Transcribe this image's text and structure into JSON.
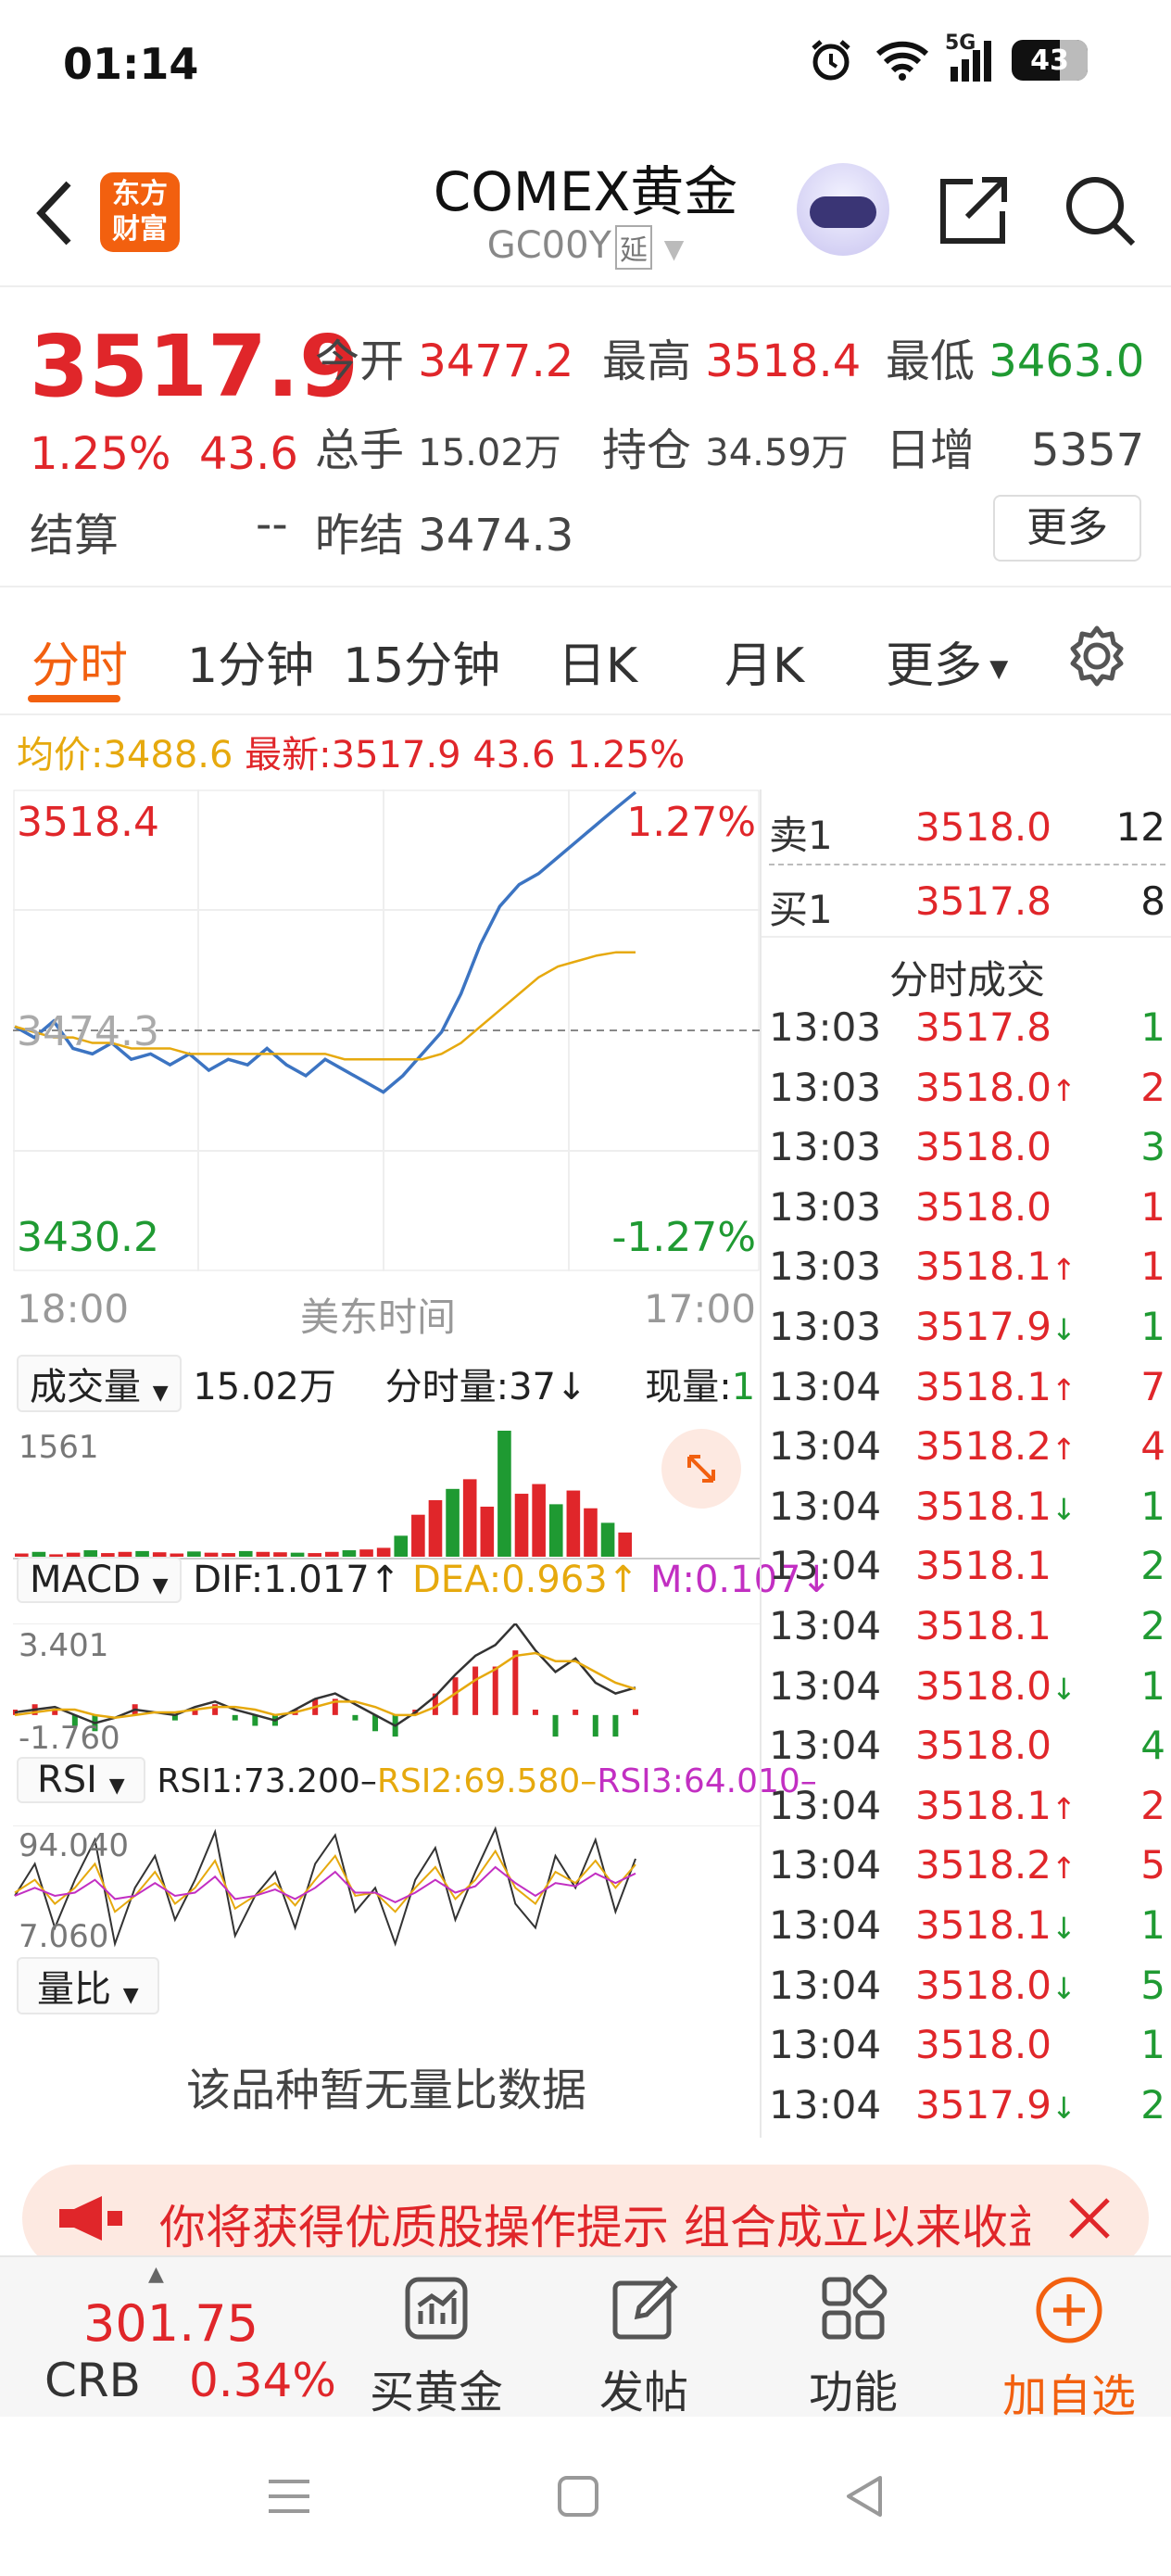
{
  "status_bar": {
    "time": "01:14",
    "network": "5G",
    "battery": "43"
  },
  "header": {
    "title": "COMEX黄金",
    "code": "GC00Y",
    "delay_tag": "延",
    "logo_text_1": "东方",
    "logo_text_2": "财富"
  },
  "quote": {
    "price": "3517.9",
    "change_pct": "1.25%",
    "change": "43.6",
    "open_label": "今开",
    "open": "3477.2",
    "high_label": "最高",
    "high": "3518.4",
    "low_label": "最低",
    "low": "3463.0",
    "volume_label": "总手",
    "volume": "15.02万",
    "oi_label": "持仓",
    "oi": "34.59万",
    "daily_inc_label": "日增",
    "daily_inc": "5357",
    "settle_label": "结算",
    "settle": "--",
    "prev_settle_label": "昨结",
    "prev_settle": "3474.3",
    "more_label": "更多"
  },
  "tabs": [
    {
      "label": "分时"
    },
    {
      "label": "1分钟"
    },
    {
      "label": "15分钟"
    },
    {
      "label": "日K"
    },
    {
      "label": "月K"
    },
    {
      "label": "更多"
    }
  ],
  "avg_line": {
    "avg_label": "均价:",
    "avg": "3488.6",
    "latest_label": "最新:",
    "latest": "3517.9",
    "chg": "43.6",
    "pct": "1.25%"
  },
  "chart_data": [
    {
      "type": "line",
      "x_start_label": "18:00",
      "x_end_label": "17:00",
      "x_center_label": "美东时间",
      "y_top": "3518.4",
      "y_bottom": "3430.2",
      "y_mid": "3474.3",
      "pct_top": "1.27%",
      "pct_bottom": "-1.27%",
      "ylim": [
        3430.2,
        3518.4
      ],
      "series": [
        {
          "values": [
            3475,
            3473,
            3476,
            3471,
            3470,
            3472,
            3469,
            3470,
            3468,
            3470,
            3467,
            3469,
            3468,
            3471,
            3468,
            3466,
            3469,
            3467,
            3465,
            3463,
            3466,
            3470,
            3474,
            3481,
            3490,
            3497,
            3501,
            3503,
            3506,
            3509,
            3512,
            3515,
            3517.9
          ]
        },
        {
          "values": [
            3475,
            3474,
            3473,
            3473,
            3472,
            3472,
            3471,
            3471,
            3471,
            3470,
            3470,
            3470,
            3470,
            3470,
            3470,
            3470,
            3470,
            3469,
            3469,
            3469,
            3469,
            3469,
            3470,
            3472,
            3475,
            3478,
            3481,
            3484,
            3486,
            3487,
            3488,
            3488.6,
            3488.6
          ]
        }
      ]
    },
    {
      "type": "bar",
      "ymax": "1561",
      "values": [
        40,
        60,
        30,
        50,
        80,
        45,
        60,
        70,
        55,
        40,
        65,
        50,
        45,
        70,
        60,
        55,
        50,
        45,
        60,
        80,
        90,
        110,
        260,
        520,
        700,
        840,
        960,
        620,
        1561,
        780,
        900,
        650,
        820,
        600,
        420,
        300
      ]
    },
    {
      "type": "line",
      "ymax": "3.401",
      "ymin": "-1.760",
      "series": [
        {
          "values": [
            0.1,
            0.2,
            0.3,
            0.0,
            -0.3,
            -0.1,
            0.2,
            0.1,
            0.0,
            0.3,
            0.5,
            0.2,
            0.0,
            -0.2,
            0.2,
            0.6,
            0.8,
            0.4,
            0.0,
            -0.4,
            0.1,
            0.7,
            1.5,
            2.2,
            2.6,
            3.4,
            2.4,
            1.6,
            2.1,
            1.2,
            0.8,
            1.017
          ]
        },
        {
          "values": [
            0.0,
            0.1,
            0.2,
            0.2,
            0.0,
            -0.1,
            0.0,
            0.1,
            0.1,
            0.2,
            0.3,
            0.3,
            0.2,
            0.0,
            0.1,
            0.3,
            0.5,
            0.5,
            0.3,
            0.0,
            0.0,
            0.3,
            0.8,
            1.3,
            1.7,
            2.2,
            2.3,
            2.0,
            2.0,
            1.6,
            1.2,
            0.963
          ]
        },
        {
          "values": [
            0.1,
            0.2,
            0.1,
            -0.2,
            -0.3,
            0.0,
            0.2,
            0.0,
            -0.1,
            0.1,
            0.2,
            -0.1,
            -0.2,
            -0.2,
            0.1,
            0.3,
            0.3,
            -0.1,
            -0.3,
            -0.4,
            0.1,
            0.4,
            0.7,
            0.9,
            0.9,
            1.2,
            0.1,
            -0.4,
            0.1,
            -0.4,
            -0.4,
            0.107
          ]
        }
      ]
    },
    {
      "type": "line",
      "ymax": "94.040",
      "ymin": "7.060",
      "series": [
        {
          "values": [
            50,
            70,
            30,
            60,
            85,
            20,
            55,
            75,
            35,
            60,
            90,
            25,
            50,
            65,
            30,
            70,
            88,
            40,
            55,
            20,
            60,
            80,
            35,
            65,
            92,
            45,
            30,
            75,
            55,
            85,
            40,
            73.2
          ]
        },
        {
          "values": [
            52,
            60,
            45,
            55,
            70,
            40,
            50,
            65,
            45,
            55,
            72,
            42,
            50,
            58,
            44,
            60,
            75,
            50,
            52,
            40,
            55,
            68,
            48,
            60,
            78,
            55,
            45,
            65,
            58,
            72,
            55,
            69.58
          ]
        },
        {
          "values": [
            50,
            55,
            50,
            52,
            60,
            48,
            50,
            58,
            50,
            52,
            62,
            48,
            50,
            54,
            48,
            55,
            65,
            52,
            52,
            46,
            52,
            60,
            52,
            56,
            68,
            58,
            50,
            58,
            56,
            64,
            58,
            64.01
          ]
        }
      ]
    }
  ],
  "volume": {
    "label": "成交量",
    "total": "15.02万",
    "tick_label": "分时量:",
    "tick": "37↓",
    "now_label": "现量:",
    "now": "1"
  },
  "macd": {
    "label": "MACD",
    "dif": "DIF:1.017↑",
    "dea": "DEA:0.963↑",
    "m": "M:0.107↓"
  },
  "rsi": {
    "label": "RSI",
    "rsi1": "RSI1:73.200–",
    "rsi2": "RSI2:69.580–",
    "rsi3": "RSI3:64.010–"
  },
  "volume_ratio": {
    "label": "量比",
    "empty": "该品种暂无量比数据"
  },
  "order_book": {
    "sell_label": "卖1",
    "sell_price": "3518.0",
    "sell_qty": "12",
    "buy_label": "买1",
    "buy_price": "3517.8",
    "buy_qty": "8",
    "title": "分时成交",
    "ticks": [
      {
        "time": "13:03",
        "price": "3517.8",
        "arrow": "",
        "qty": "1",
        "color": "green"
      },
      {
        "time": "13:03",
        "price": "3518.0",
        "arrow": "↑",
        "qty": "2",
        "color": "red"
      },
      {
        "time": "13:03",
        "price": "3518.0",
        "arrow": "",
        "qty": "3",
        "color": "green"
      },
      {
        "time": "13:03",
        "price": "3518.0",
        "arrow": "",
        "qty": "1",
        "color": "red"
      },
      {
        "time": "13:03",
        "price": "3518.1",
        "arrow": "↑",
        "qty": "1",
        "color": "red"
      },
      {
        "time": "13:03",
        "price": "3517.9",
        "arrow": "↓",
        "qty": "1",
        "color": "green"
      },
      {
        "time": "13:04",
        "price": "3518.1",
        "arrow": "↑",
        "qty": "7",
        "color": "red"
      },
      {
        "time": "13:04",
        "price": "3518.2",
        "arrow": "↑",
        "qty": "4",
        "color": "red"
      },
      {
        "time": "13:04",
        "price": "3518.1",
        "arrow": "↓",
        "qty": "1",
        "color": "green"
      },
      {
        "time": "13:04",
        "price": "3518.1",
        "arrow": "",
        "qty": "2",
        "color": "green"
      },
      {
        "time": "13:04",
        "price": "3518.1",
        "arrow": "",
        "qty": "2",
        "color": "green"
      },
      {
        "time": "13:04",
        "price": "3518.0",
        "arrow": "↓",
        "qty": "1",
        "color": "green"
      },
      {
        "time": "13:04",
        "price": "3518.0",
        "arrow": "",
        "qty": "4",
        "color": "green"
      },
      {
        "time": "13:04",
        "price": "3518.1",
        "arrow": "↑",
        "qty": "2",
        "color": "red"
      },
      {
        "time": "13:04",
        "price": "3518.2",
        "arrow": "↑",
        "qty": "5",
        "color": "red"
      },
      {
        "time": "13:04",
        "price": "3518.1",
        "arrow": "↓",
        "qty": "1",
        "color": "green"
      },
      {
        "time": "13:04",
        "price": "3518.0",
        "arrow": "↓",
        "qty": "5",
        "color": "green"
      },
      {
        "time": "13:04",
        "price": "3518.0",
        "arrow": "",
        "qty": "1",
        "color": "green"
      },
      {
        "time": "13:04",
        "price": "3517.9",
        "arrow": "↓",
        "qty": "2",
        "color": "green"
      }
    ]
  },
  "banner": {
    "text": "你将获得优质股操作提示 组合成立以来收益"
  },
  "toolbar": {
    "crb_value": "301.75",
    "crb_label": "CRB",
    "crb_pct": "0.34%",
    "buy_gold": "买黄金",
    "post": "发帖",
    "functions": "功能",
    "add_watch": "加自选"
  },
  "colors": {
    "up": "#e0262a",
    "down": "#1f9a32",
    "accent": "#f2600f",
    "price_line": "#3c74c2",
    "avg_line": "#e6a90e",
    "rsi3": "#c22fc2"
  }
}
